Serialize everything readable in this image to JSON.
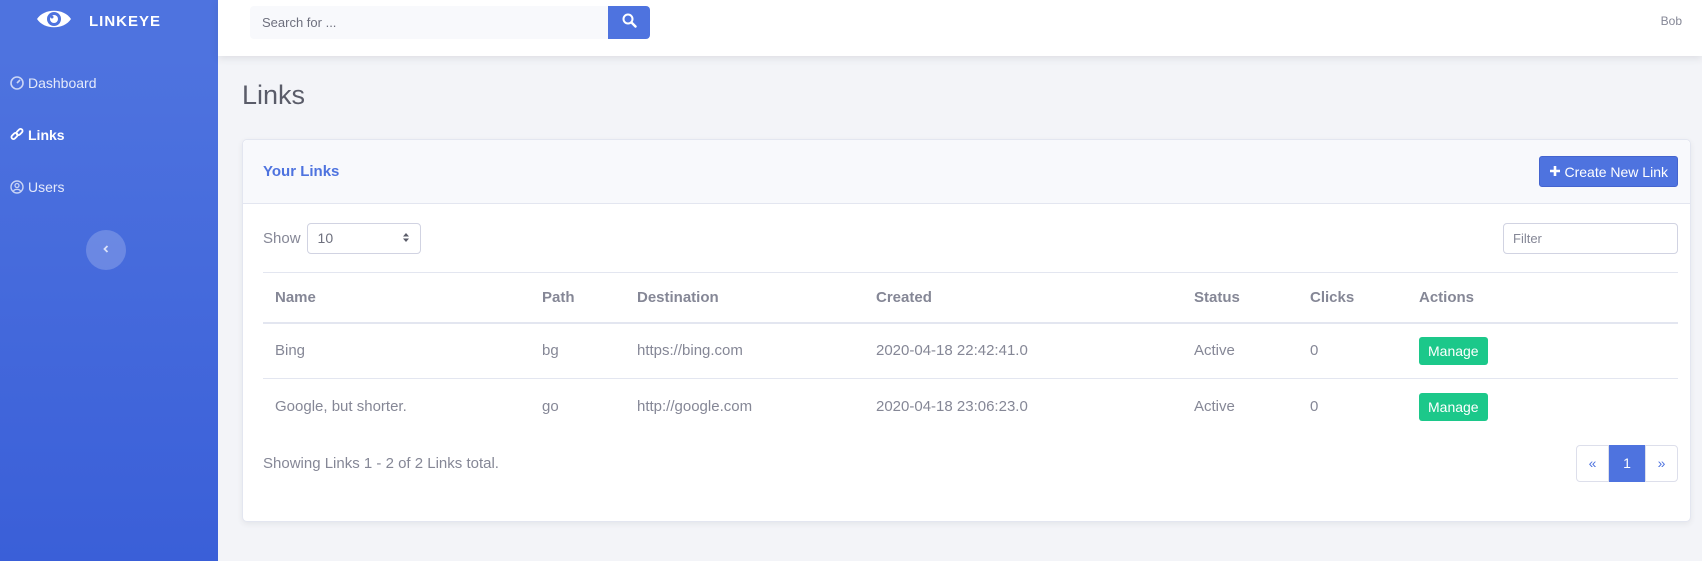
{
  "brand": {
    "name": "LINKEYE"
  },
  "sidebar": {
    "items": [
      {
        "label": "Dashboard",
        "icon": "tachometer-icon",
        "active": false
      },
      {
        "label": "Links",
        "icon": "link-icon",
        "active": true
      },
      {
        "label": "Users",
        "icon": "user-circle-icon",
        "active": false
      }
    ],
    "toggle_icon": "chevron-left-icon"
  },
  "topbar": {
    "search_placeholder": "Search for ...",
    "search_icon": "search-icon",
    "user_name": "Bob"
  },
  "page": {
    "title": "Links"
  },
  "card": {
    "title": "Your Links",
    "create_button": "Create New Link",
    "show_label": "Show",
    "page_size": "10",
    "filter_placeholder": "Filter",
    "columns": [
      "Name",
      "Path",
      "Destination",
      "Created",
      "Status",
      "Clicks",
      "Actions"
    ],
    "rows": [
      {
        "name": "Bing",
        "path": "bg",
        "destination": "https://bing.com",
        "created": "2020-04-18 22:42:41.0",
        "status": "Active",
        "clicks": "0",
        "action": "Manage"
      },
      {
        "name": "Google, but shorter.",
        "path": "go",
        "destination": "http://google.com",
        "created": "2020-04-18 23:06:23.0",
        "status": "Active",
        "clicks": "0",
        "action": "Manage"
      }
    ],
    "summary": "Showing Links 1 - 2 of 2 Links total.",
    "pagination": {
      "prev": "«",
      "current": "1",
      "next": "»"
    }
  },
  "colors": {
    "primary": "#4e73df",
    "success": "#1cc88a",
    "text": "#858796"
  }
}
